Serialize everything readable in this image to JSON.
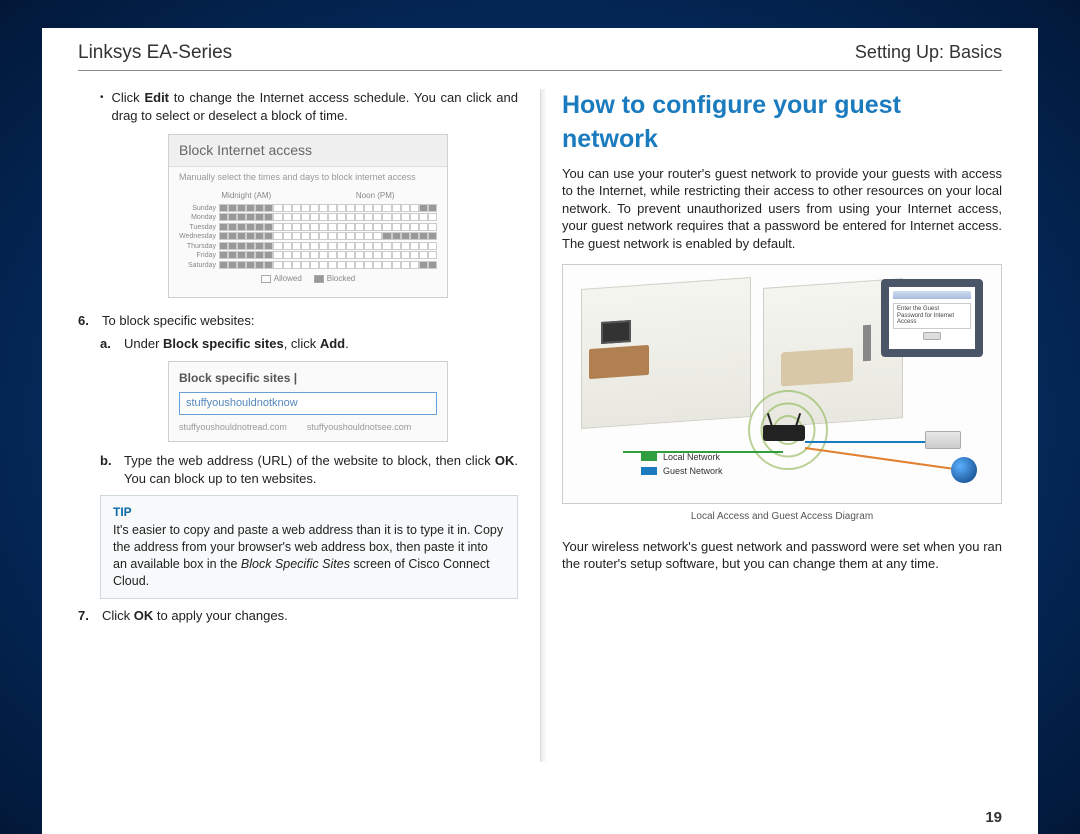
{
  "header": {
    "left": "Linksys EA-Series",
    "right": "Setting Up: Basics"
  },
  "left_col": {
    "bullet_edit_pre": "Click ",
    "bullet_edit_bold": "Edit",
    "bullet_edit_post": " to change the Internet access schedule. You can click and drag to select or deselect a block of time.",
    "shot1": {
      "title": "Block Internet access",
      "subtitle": "Manually select the times and days to block internet access",
      "am_label": "Midnight (AM)",
      "pm_label": "Noon (PM)",
      "days": [
        "Sunday",
        "Monday",
        "Tuesday",
        "Wednesday",
        "Thursday",
        "Friday",
        "Saturday"
      ],
      "legend_allowed": "Allowed",
      "legend_blocked": "Blocked"
    },
    "step6_num": "6.",
    "step6_text": "To block specific websites:",
    "step6a_label": "a.",
    "step6a_pre": "Under ",
    "step6a_bold1": "Block specific sites",
    "step6a_mid": ", click ",
    "step6a_bold2": "Add",
    "step6a_post": ".",
    "shot2": {
      "title": "Block specific sites  |",
      "input_value": "stuffyoushouldnotknow",
      "url1": "stuffyoushouldnotread.com",
      "url2": "stuffyoushouldnotsee.com"
    },
    "step6b_label": "b.",
    "step6b_pre": "Type the web address (URL) of the website to block, then click ",
    "step6b_bold": "OK",
    "step6b_post": ". You can block up to ten websites.",
    "tip_label": "TIP",
    "tip_text_pre": "It's easier to copy and paste a web address than it is to type it in. Copy the address from your browser's web address box, then paste it into an available box in the ",
    "tip_text_italic": "Block Specific Sites",
    "tip_text_post": " screen of Cisco Connect Cloud.",
    "step7_num": "7.",
    "step7_pre": "Click ",
    "step7_bold": "OK",
    "step7_post": " to apply your changes."
  },
  "right_col": {
    "heading": "How to configure your guest network",
    "para1": "You can use your router's guest network to provide your guests with access to the Internet, while restricting their access to other resources on your local network. To prevent unauthorized users from using your Internet access, your guest network requires that a password be entered for Internet access. The guest network is enabled by default.",
    "laptop_text": "Enter the Guest Password for Internet Access",
    "legend_local": "Local Network",
    "legend_guest": "Guest Network",
    "diagram_caption": "Local Access and Guest Access Diagram",
    "para2": "Your wireless network's guest network and password were set when you ran the router's setup software, but you can change them at any time."
  },
  "page_number": "19"
}
